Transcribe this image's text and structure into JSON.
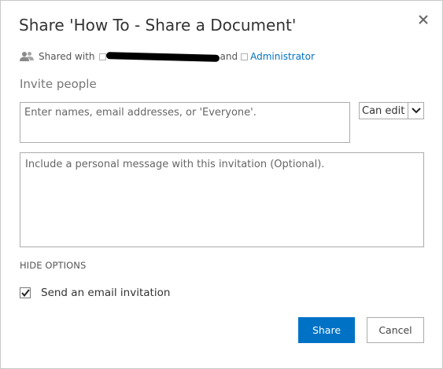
{
  "dialog": {
    "title": "Share 'How To - Share a Document'",
    "close_icon": "close-icon"
  },
  "shared_with": {
    "icon": "people-icon",
    "label": "Shared with",
    "users": [
      "",
      "",
      "Administrator"
    ],
    "and_text": "and",
    "redaction_color": "#000000"
  },
  "invite": {
    "label": "Invite people",
    "names_placeholder": "Enter names, email addresses, or 'Everyone'.",
    "permission": {
      "selected": "Can edit",
      "icon": "chevron-down-icon"
    },
    "message_placeholder": "Include a personal message with this invitation (Optional)."
  },
  "options": {
    "toggle_label": "HIDE OPTIONS",
    "send_email": {
      "label": "Send an email invitation",
      "checked": true,
      "icon": "checkmark-icon"
    }
  },
  "buttons": {
    "share": "Share",
    "cancel": "Cancel"
  },
  "colors": {
    "accent": "#0072c6",
    "link": "#0072c6"
  }
}
